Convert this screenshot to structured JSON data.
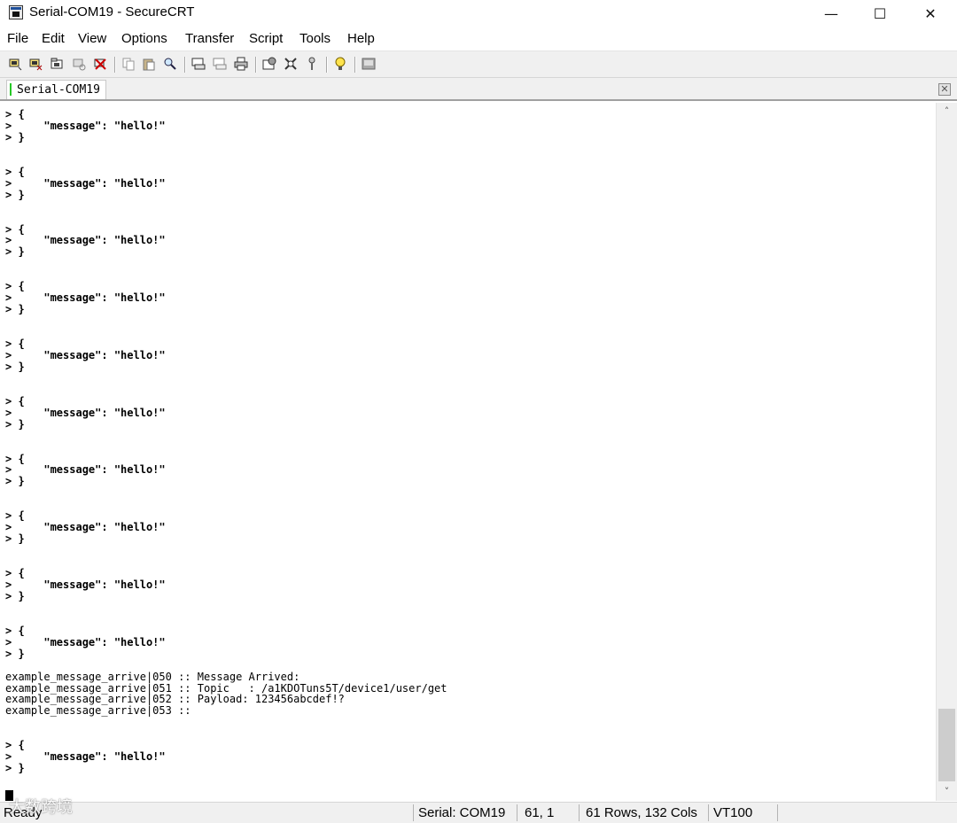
{
  "window": {
    "title": "Serial-COM19 - SecureCRT",
    "minimize_glyph": "—",
    "maximize_glyph": "☐",
    "close_glyph": "✕"
  },
  "menu": [
    "File",
    "Edit",
    "View",
    "Options",
    "Transfer",
    "Script",
    "Tools",
    "Help"
  ],
  "toolbar_icons": [
    "connect-icon",
    "quick-connect-icon",
    "connect-in-tab-icon",
    "reconnect-icon",
    "disconnect-icon",
    "copy-icon",
    "paste-icon",
    "find-icon",
    "print-screen-icon",
    "print-selection-icon",
    "print-icon",
    "session-options-icon",
    "global-options-icon",
    "keymap-icon",
    "help-icon",
    "sftp-icon"
  ],
  "tab": {
    "label": "Serial-COM19",
    "status_color": "#27c827",
    "close_glyph": "✕"
  },
  "terminal": {
    "lines": [
      {
        "text": "> {",
        "bold": true
      },
      {
        "text": ">     \"message\": \"hello!\"",
        "bold": true
      },
      {
        "text": "> }",
        "bold": true
      },
      {
        "text": "",
        "bold": false
      },
      {
        "text": "",
        "bold": false
      },
      {
        "text": "> {",
        "bold": true
      },
      {
        "text": ">     \"message\": \"hello!\"",
        "bold": true
      },
      {
        "text": "> }",
        "bold": true
      },
      {
        "text": "",
        "bold": false
      },
      {
        "text": "",
        "bold": false
      },
      {
        "text": "> {",
        "bold": true
      },
      {
        "text": ">     \"message\": \"hello!\"",
        "bold": true
      },
      {
        "text": "> }",
        "bold": true
      },
      {
        "text": "",
        "bold": false
      },
      {
        "text": "",
        "bold": false
      },
      {
        "text": "> {",
        "bold": true
      },
      {
        "text": ">     \"message\": \"hello!\"",
        "bold": true
      },
      {
        "text": "> }",
        "bold": true
      },
      {
        "text": "",
        "bold": false
      },
      {
        "text": "",
        "bold": false
      },
      {
        "text": "> {",
        "bold": true
      },
      {
        "text": ">     \"message\": \"hello!\"",
        "bold": true
      },
      {
        "text": "> }",
        "bold": true
      },
      {
        "text": "",
        "bold": false
      },
      {
        "text": "",
        "bold": false
      },
      {
        "text": "> {",
        "bold": true
      },
      {
        "text": ">     \"message\": \"hello!\"",
        "bold": true
      },
      {
        "text": "> }",
        "bold": true
      },
      {
        "text": "",
        "bold": false
      },
      {
        "text": "",
        "bold": false
      },
      {
        "text": "> {",
        "bold": true
      },
      {
        "text": ">     \"message\": \"hello!\"",
        "bold": true
      },
      {
        "text": "> }",
        "bold": true
      },
      {
        "text": "",
        "bold": false
      },
      {
        "text": "",
        "bold": false
      },
      {
        "text": "> {",
        "bold": true
      },
      {
        "text": ">     \"message\": \"hello!\"",
        "bold": true
      },
      {
        "text": "> }",
        "bold": true
      },
      {
        "text": "",
        "bold": false
      },
      {
        "text": "",
        "bold": false
      },
      {
        "text": "> {",
        "bold": true
      },
      {
        "text": ">     \"message\": \"hello!\"",
        "bold": true
      },
      {
        "text": "> }",
        "bold": true
      },
      {
        "text": "",
        "bold": false
      },
      {
        "text": "",
        "bold": false
      },
      {
        "text": "> {",
        "bold": true
      },
      {
        "text": ">     \"message\": \"hello!\"",
        "bold": true
      },
      {
        "text": "> }",
        "bold": true
      },
      {
        "text": "",
        "bold": false
      },
      {
        "text": "example_message_arrive|050 :: Message Arrived:",
        "bold": false
      },
      {
        "text": "example_message_arrive|051 :: Topic   : /a1KDOTuns5T/device1/user/get",
        "bold": false
      },
      {
        "text": "example_message_arrive|052 :: Payload: 123456abcdef!?",
        "bold": false
      },
      {
        "text": "example_message_arrive|053 ::",
        "bold": false
      },
      {
        "text": "",
        "bold": false
      },
      {
        "text": "",
        "bold": false
      },
      {
        "text": "> {",
        "bold": true
      },
      {
        "text": ">     \"message\": \"hello!\"",
        "bold": true
      },
      {
        "text": "> }",
        "bold": true
      }
    ]
  },
  "statusbar": {
    "ready": "Ready",
    "connection": "Serial: COM19",
    "cursor_pos": "61,  1",
    "dimensions": "61 Rows, 132 Cols",
    "emulation": "VT100"
  },
  "watermark": "大数跨境"
}
